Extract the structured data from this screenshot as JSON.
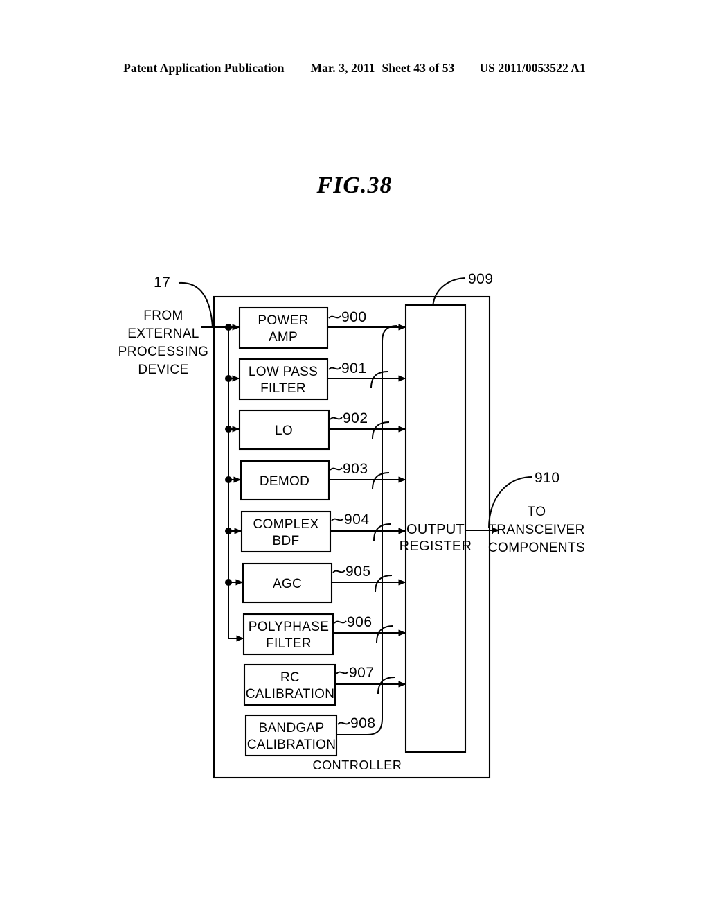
{
  "header": {
    "publication": "Patent Application Publication",
    "date": "Mar. 3, 2011",
    "sheet": "Sheet 43 of 53",
    "patent_number": "US 2011/0053522 A1"
  },
  "figure": {
    "title": "FIG.38"
  },
  "annotations": {
    "input_ref": "17",
    "input_label_line1": "FROM",
    "input_label_line2": "EXTERNAL",
    "input_label_line3": "PROCESSING",
    "input_label_line4": "DEVICE",
    "controller_ref": "909",
    "output_ref": "910",
    "output_label_line1": "TO",
    "output_label_line2": "TRANSCEIVER",
    "output_label_line3": "COMPONENTS",
    "controller_label": "CONTROLLER"
  },
  "output_register": {
    "line1": "OUTPUT",
    "line2": "REGISTER"
  },
  "blocks": [
    {
      "ref": "900",
      "line1": "POWER",
      "line2": "AMP"
    },
    {
      "ref": "901",
      "line1": "LOW PASS",
      "line2": "FILTER"
    },
    {
      "ref": "902",
      "line1": "LO",
      "line2": ""
    },
    {
      "ref": "903",
      "line1": "DEMOD",
      "line2": ""
    },
    {
      "ref": "904",
      "line1": "COMPLEX",
      "line2": "BDF"
    },
    {
      "ref": "905",
      "line1": "AGC",
      "line2": ""
    },
    {
      "ref": "906",
      "line1": "POLYPHASE",
      "line2": "FILTER"
    },
    {
      "ref": "907",
      "line1": "RC",
      "line2": "CALIBRATION"
    },
    {
      "ref": "908",
      "line1": "BANDGAP",
      "line2": "CALIBRATION"
    }
  ],
  "colors": {
    "ink": "#000000",
    "paper": "#ffffff"
  }
}
